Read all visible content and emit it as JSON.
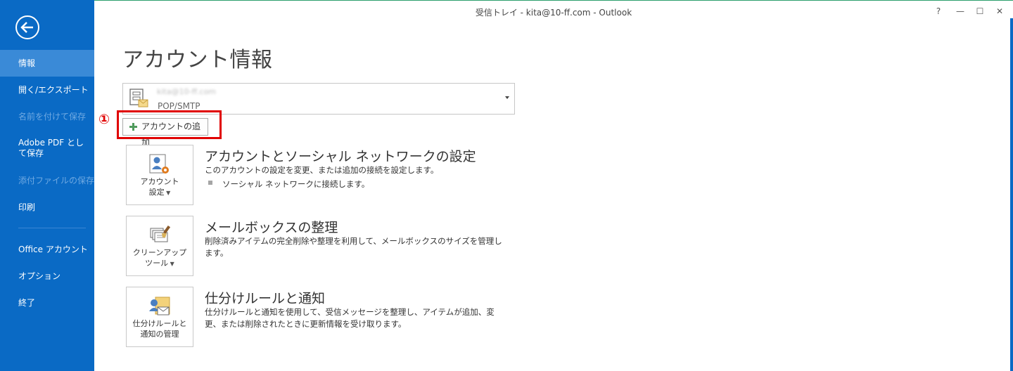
{
  "window": {
    "title": "受信トレイ - kita@10-ff.com - Outlook",
    "controls": {
      "help": "?",
      "minimize": "—",
      "maximize": "☐",
      "close": "✕"
    }
  },
  "sidebar": {
    "items": [
      {
        "label": "情報",
        "state": "selected"
      },
      {
        "label": "開く/エクスポート",
        "state": "normal"
      },
      {
        "label": "名前を付けて保存",
        "state": "disabled"
      },
      {
        "label": "Adobe PDF として保存",
        "state": "normal"
      },
      {
        "label": "添付ファイルの保存",
        "state": "disabled"
      },
      {
        "label": "印刷",
        "state": "normal"
      },
      {
        "label": "Office アカウント",
        "state": "normal"
      },
      {
        "label": "オプション",
        "state": "normal"
      },
      {
        "label": "終了",
        "state": "normal"
      }
    ]
  },
  "main": {
    "page_title": "アカウント情報",
    "account": {
      "email_blurred": "kita@10-ff.com",
      "type": "POP/SMTP"
    },
    "add_account": {
      "callout": "①",
      "label": "アカウントの追加"
    },
    "sections": [
      {
        "tile_label_1": "アカウント",
        "tile_label_2": "設定",
        "title": "アカウントとソーシャル ネットワークの設定",
        "desc": "このアカウントの設定を変更、または追加の接続を設定します。",
        "bullet": "ソーシャル ネットワークに接続します。"
      },
      {
        "tile_label_1": "クリーンアップ",
        "tile_label_2": "ツール",
        "title": "メールボックスの整理",
        "desc": "削除済みアイテムの完全削除や整理を利用して、メールボックスのサイズを管理します。"
      },
      {
        "tile_label_1": "仕分けルールと",
        "tile_label_2": "通知の管理",
        "title": "仕分けルールと通知",
        "desc": "仕分けルールと通知を使用して、受信メッセージを整理し、アイテムが追加、変更、または削除されたときに更新情報を受け取ります。"
      }
    ]
  },
  "colors": {
    "sidebar_bg": "#0a6ac5",
    "sidebar_selected": "#3a8ad7",
    "highlight": "#e00000"
  }
}
